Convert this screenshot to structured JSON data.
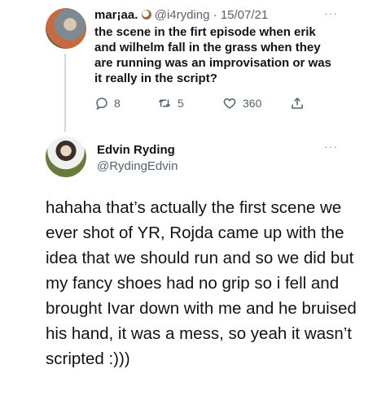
{
  "tweet1": {
    "display_name": "mar¡aa.",
    "emoji_icon": "coconut-icon",
    "handle": "@i4ryding",
    "separator": "·",
    "date": "15/07/21",
    "text": "the scene in the firt episode when erik and wilhelm fall in the grass when they are running was an improvisation or was it really in the script?",
    "actions": {
      "replies": "8",
      "retweets": "5",
      "likes": "360"
    },
    "more": "···"
  },
  "tweet2": {
    "display_name": "Edvin Ryding",
    "handle": "@RydingEdvin",
    "more": "···",
    "text": "hahaha that’s actually the first scene we ever shot of YR, Rojda came up with the idea that we should run and so we did but my fancy shoes had no grip so i fell and brought Ivar down with me and he bruised his hand, it was a mess, so yeah it wasn’t scripted :)))"
  },
  "colors": {
    "text_primary": "#0f1419",
    "text_secondary": "#536471",
    "thread_line": "#cfd9de"
  }
}
